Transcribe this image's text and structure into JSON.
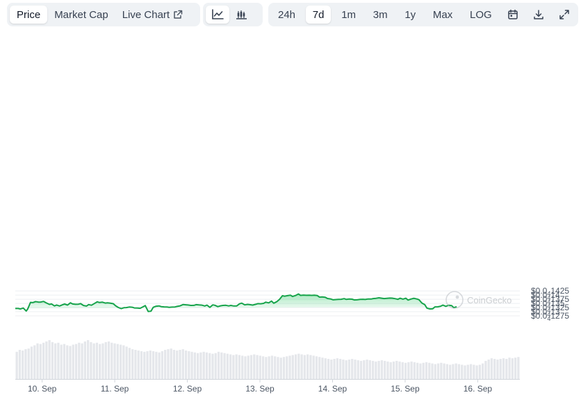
{
  "tabs": [
    {
      "label": "Price",
      "active": true,
      "external": false
    },
    {
      "label": "Market Cap",
      "active": false,
      "external": false
    },
    {
      "label": "Live Chart",
      "active": false,
      "external": true
    }
  ],
  "chart_styles": [
    {
      "icon": "line-chart-icon",
      "active": true
    },
    {
      "icon": "candlestick-chart-icon",
      "active": false
    }
  ],
  "ranges": [
    {
      "label": "24h",
      "active": false
    },
    {
      "label": "7d",
      "active": true
    },
    {
      "label": "1m",
      "active": false
    },
    {
      "label": "3m",
      "active": false
    },
    {
      "label": "1y",
      "active": false
    },
    {
      "label": "Max",
      "active": false
    },
    {
      "label": "LOG",
      "active": false
    }
  ],
  "tools": [
    {
      "icon": "calendar-icon"
    },
    {
      "icon": "download-icon"
    },
    {
      "icon": "expand-icon"
    }
  ],
  "watermark": "CoinGecko",
  "colors": {
    "line": "#16a34a",
    "fill": "#22c55e",
    "volume": "#e5e7eb",
    "grid": "#eceff2",
    "axis_text": "#4b5563"
  },
  "chart_data": {
    "type": "area",
    "yticks": [
      {
        "value": 1.275e-05,
        "prefix": "$0.0",
        "sub": "4",
        "suffix": "1275"
      },
      {
        "value": 1.3e-05,
        "prefix": "$0.0",
        "sub": "4",
        "suffix": "13"
      },
      {
        "value": 1.325e-05,
        "prefix": "$0.0",
        "sub": "4",
        "suffix": "1325"
      },
      {
        "value": 1.35e-05,
        "prefix": "$0.0",
        "sub": "4",
        "suffix": "135"
      },
      {
        "value": 1.375e-05,
        "prefix": "$0.0",
        "sub": "4",
        "suffix": "1375"
      },
      {
        "value": 1.4e-05,
        "prefix": "$0.0",
        "sub": "4",
        "suffix": "14"
      },
      {
        "value": 1.425e-05,
        "prefix": "$0.0",
        "sub": "4",
        "suffix": "1425"
      }
    ],
    "ylim": [
      1.275e-05,
      1.425e-05
    ],
    "xlim": [
      9.63,
      16.58
    ],
    "xticks": [
      {
        "label": "10. Sep",
        "value": 10
      },
      {
        "label": "11. Sep",
        "value": 11
      },
      {
        "label": "12. Sep",
        "value": 12
      },
      {
        "label": "13. Sep",
        "value": 13
      },
      {
        "label": "14. Sep",
        "value": 14
      },
      {
        "label": "15. Sep",
        "value": 15
      },
      {
        "label": "16. Sep",
        "value": 16
      }
    ],
    "x": [
      9.63,
      9.67,
      9.7,
      9.74,
      9.78,
      9.8,
      9.84,
      9.87,
      9.91,
      9.95,
      9.98,
      10.02,
      10.06,
      10.1,
      10.13,
      10.17,
      10.2,
      10.24,
      10.28,
      10.31,
      10.35,
      10.39,
      10.42,
      10.46,
      10.5,
      10.53,
      10.57,
      10.61,
      10.64,
      10.68,
      10.72,
      10.76,
      10.79,
      10.83,
      10.87,
      10.9,
      10.94,
      10.98,
      11.01,
      11.05,
      11.09,
      11.13,
      11.16,
      11.2,
      11.24,
      11.27,
      11.31,
      11.35,
      11.38,
      11.42,
      11.46,
      11.5,
      11.53,
      11.57,
      11.61,
      11.64,
      11.68,
      11.72,
      11.75,
      11.79,
      11.83,
      11.86,
      11.9,
      11.94,
      11.98,
      12.01,
      12.05,
      12.09,
      12.12,
      12.16,
      12.2,
      12.24,
      12.27,
      12.31,
      12.35,
      12.38,
      12.42,
      12.46,
      12.49,
      12.53,
      12.57,
      12.6,
      12.64,
      12.68,
      12.72,
      12.75,
      12.79,
      12.83,
      12.86,
      12.9,
      12.94,
      12.97,
      13.01,
      13.05,
      13.08,
      13.12,
      13.16,
      13.19,
      13.23,
      13.27,
      13.31,
      13.34,
      13.38,
      13.42,
      13.45,
      13.49,
      13.53,
      13.56,
      13.6,
      13.64,
      13.68,
      13.71,
      13.75,
      13.79,
      13.82,
      13.86,
      13.9,
      13.93,
      13.97,
      14.01,
      14.05,
      14.08,
      14.12,
      14.16,
      14.19,
      14.23,
      14.27,
      14.3,
      14.34,
      14.38,
      14.42,
      14.45,
      14.49,
      14.53,
      14.56,
      14.6,
      14.64,
      14.67,
      14.71,
      14.75,
      14.79,
      14.82,
      14.86,
      14.9,
      14.93,
      14.97,
      15.01,
      15.04,
      15.08,
      15.12,
      15.16,
      15.19,
      15.23,
      15.27,
      15.3,
      15.34,
      15.38,
      15.41,
      15.45,
      15.49,
      15.52,
      15.56,
      15.6,
      15.64,
      15.67,
      15.71,
      15.75,
      15.78,
      15.82,
      15.86,
      15.9,
      15.93,
      15.97,
      16.01,
      16.04,
      16.08,
      16.12,
      16.15,
      16.19,
      16.23,
      16.27,
      16.3,
      16.34,
      16.38,
      16.41,
      16.45,
      16.49,
      16.52,
      16.56,
      16.58
    ],
    "y": [
      1.3195e-05,
      1.3195e-05,
      1.3164e-05,
      1.3219e-05,
      1.3039e-05,
      1.3156e-05,
      1.3562e-05,
      1.3548e-05,
      1.3609e-05,
      1.3578e-05,
      1.3584e-05,
      1.3621e-05,
      1.3523e-05,
      1.3439e-05,
      1.3468e-05,
      1.3349e-05,
      1.3404e-05,
      1.3343e-05,
      1.3414e-05,
      1.3463e-05,
      1.3398e-05,
      1.3537e-05,
      1.3468e-05,
      1.3445e-05,
      1.3455e-05,
      1.3487e-05,
      1.3372e-05,
      1.3339e-05,
      1.3427e-05,
      1.3392e-05,
      1.3494e-05,
      1.3596e-05,
      1.3552e-05,
      1.3576e-05,
      1.3521e-05,
      1.3537e-05,
      1.3513e-05,
      1.3482e-05,
      1.3361e-05,
      1.3253e-05,
      1.3185e-05,
      1.3246e-05,
      1.3248e-05,
      1.3282e-05,
      1.3268e-05,
      1.3229e-05,
      1.3225e-05,
      1.3205e-05,
      1.3272e-05,
      1.3371e-05,
      1.3012e-05,
      1.3035e-05,
      1.3263e-05,
      1.3334e-05,
      1.3348e-05,
      1.3305e-05,
      1.3292e-05,
      1.3282e-05,
      1.3262e-05,
      1.3278e-05,
      1.3285e-05,
      1.3318e-05,
      1.3352e-05,
      1.3427e-05,
      1.3414e-05,
      1.3403e-05,
      1.338e-05,
      1.3381e-05,
      1.3426e-05,
      1.3406e-05,
      1.3393e-05,
      1.3346e-05,
      1.3399e-05,
      1.3259e-05,
      1.3412e-05,
      1.3388e-05,
      1.3306e-05,
      1.3357e-05,
      1.3377e-05,
      1.3385e-05,
      1.3349e-05,
      1.3378e-05,
      1.3344e-05,
      1.3348e-05,
      1.348e-05,
      1.3517e-05,
      1.3412e-05,
      1.3442e-05,
      1.3425e-05,
      1.3401e-05,
      1.3446e-05,
      1.3485e-05,
      1.3479e-05,
      1.3505e-05,
      1.3577e-05,
      1.3532e-05,
      1.3643e-05,
      1.3514e-05,
      1.3602e-05,
      1.3748e-05,
      1.3964e-05,
      1.3934e-05,
      1.3968e-05,
      1.3996e-05,
      1.3918e-05,
      1.3975e-05,
      1.4071e-05,
      1.3986e-05,
      1.4002e-05,
      1.3988e-05,
      1.3995e-05,
      1.3987e-05,
      1.3995e-05,
      1.3972e-05,
      1.3879e-05,
      1.3887e-05,
      1.3871e-05,
      1.3798e-05,
      1.377e-05,
      1.3719e-05,
      1.3734e-05,
      1.3744e-05,
      1.3749e-05,
      1.3787e-05,
      1.3743e-05,
      1.3764e-05,
      1.3756e-05,
      1.3709e-05,
      1.3716e-05,
      1.3743e-05,
      1.375e-05,
      1.374e-05,
      1.3767e-05,
      1.3763e-05,
      1.3791e-05,
      1.3811e-05,
      1.3837e-05,
      1.3817e-05,
      1.3793e-05,
      1.3807e-05,
      1.3823e-05,
      1.3816e-05,
      1.3789e-05,
      1.3748e-05,
      1.3815e-05,
      1.376e-05,
      1.3815e-05,
      1.37e-05,
      1.3764e-05,
      1.3808e-05,
      1.3767e-05,
      1.3727e-05,
      1.3525e-05,
      1.3425e-05,
      1.3215e-05,
      1.3163e-05,
      1.3172e-05,
      1.3291e-05,
      1.3296e-05,
      1.3332e-05,
      1.34e-05,
      1.3323e-05,
      1.339e-05,
      1.3369e-05,
      1.3244e-05,
      1.3294e-05
    ],
    "volume": [
      0.42,
      0.45,
      0.44,
      0.46,
      0.47,
      0.5,
      0.52,
      0.55,
      0.54,
      0.56,
      0.58,
      0.6,
      0.57,
      0.55,
      0.56,
      0.53,
      0.54,
      0.52,
      0.51,
      0.53,
      0.54,
      0.56,
      0.55,
      0.58,
      0.6,
      0.57,
      0.55,
      0.56,
      0.54,
      0.55,
      0.57,
      0.58,
      0.56,
      0.55,
      0.54,
      0.53,
      0.52,
      0.5,
      0.48,
      0.46,
      0.45,
      0.44,
      0.43,
      0.42,
      0.43,
      0.44,
      0.43,
      0.42,
      0.41,
      0.43,
      0.45,
      0.46,
      0.47,
      0.45,
      0.44,
      0.45,
      0.46,
      0.44,
      0.43,
      0.42,
      0.41,
      0.4,
      0.41,
      0.42,
      0.41,
      0.4,
      0.39,
      0.4,
      0.42,
      0.41,
      0.4,
      0.39,
      0.38,
      0.37,
      0.38,
      0.37,
      0.36,
      0.35,
      0.36,
      0.37,
      0.38,
      0.37,
      0.36,
      0.35,
      0.34,
      0.35,
      0.36,
      0.35,
      0.34,
      0.33,
      0.34,
      0.35,
      0.36,
      0.37,
      0.38,
      0.39,
      0.38,
      0.37,
      0.38,
      0.37,
      0.36,
      0.35,
      0.34,
      0.33,
      0.32,
      0.31,
      0.3,
      0.31,
      0.32,
      0.31,
      0.3,
      0.29,
      0.3,
      0.31,
      0.3,
      0.29,
      0.28,
      0.29,
      0.3,
      0.29,
      0.28,
      0.27,
      0.28,
      0.29,
      0.28,
      0.27,
      0.26,
      0.27,
      0.28,
      0.27,
      0.26,
      0.25,
      0.26,
      0.27,
      0.26,
      0.25,
      0.24,
      0.25,
      0.26,
      0.25,
      0.24,
      0.23,
      0.24,
      0.25,
      0.24,
      0.23,
      0.22,
      0.23,
      0.24,
      0.23,
      0.22,
      0.21,
      0.22,
      0.23,
      0.22,
      0.21,
      0.22,
      0.24,
      0.28,
      0.3,
      0.32,
      0.31,
      0.3,
      0.31,
      0.32,
      0.31,
      0.33,
      0.32,
      0.33,
      0.34
    ]
  }
}
